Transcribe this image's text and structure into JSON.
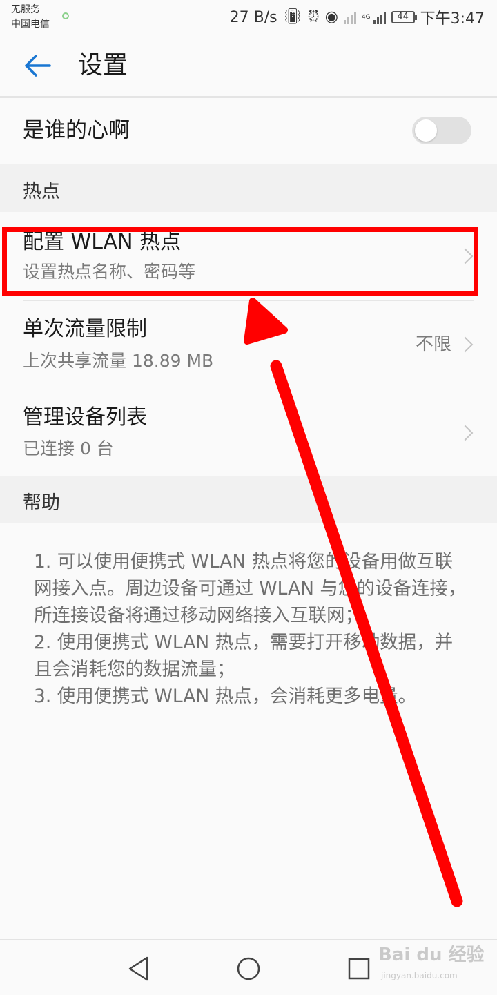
{
  "status_bar": {
    "carrier_line1": "无服务",
    "carrier_line2": "中国电信",
    "speed": "27 B/s",
    "network_label": "4G",
    "battery": "44",
    "time": "下午3:47"
  },
  "header": {
    "title": "设置",
    "back_icon": "back-arrow-icon"
  },
  "toggle_row": {
    "label": "是谁的心啊",
    "enabled": false
  },
  "sections": {
    "hotspot": "热点",
    "help": "帮助"
  },
  "list": [
    {
      "title": "配置 WLAN 热点",
      "subtitle": "设置热点名称、密码等",
      "value": ""
    },
    {
      "title": "单次流量限制",
      "subtitle": "上次共享流量 18.89 MB",
      "value": "不限"
    },
    {
      "title": "管理设备列表",
      "subtitle": "已连接 0 台",
      "value": ""
    }
  ],
  "help": {
    "line1": "1. 可以使用便携式 WLAN 热点将您的设备用做互联网接入点。周边设备可通过 WLAN 与您的设备连接，所连接设备将通过移动网络接入互联网；",
    "line2": "2. 使用便携式 WLAN 热点，需要打开移动数据，并且会消耗您的数据流量；",
    "line3": "3. 使用便携式 WLAN 热点，会消耗更多电量。"
  },
  "annotation": {
    "highlight_color": "#ff0000",
    "arrow_color": "#ff0000"
  },
  "watermark": {
    "brand": "Bai du 经验",
    "url": "jingyan.baidu.com"
  },
  "colors": {
    "accent": "#1976d2",
    "background": "#fafafa",
    "section_bg": "#f1f1f1"
  }
}
